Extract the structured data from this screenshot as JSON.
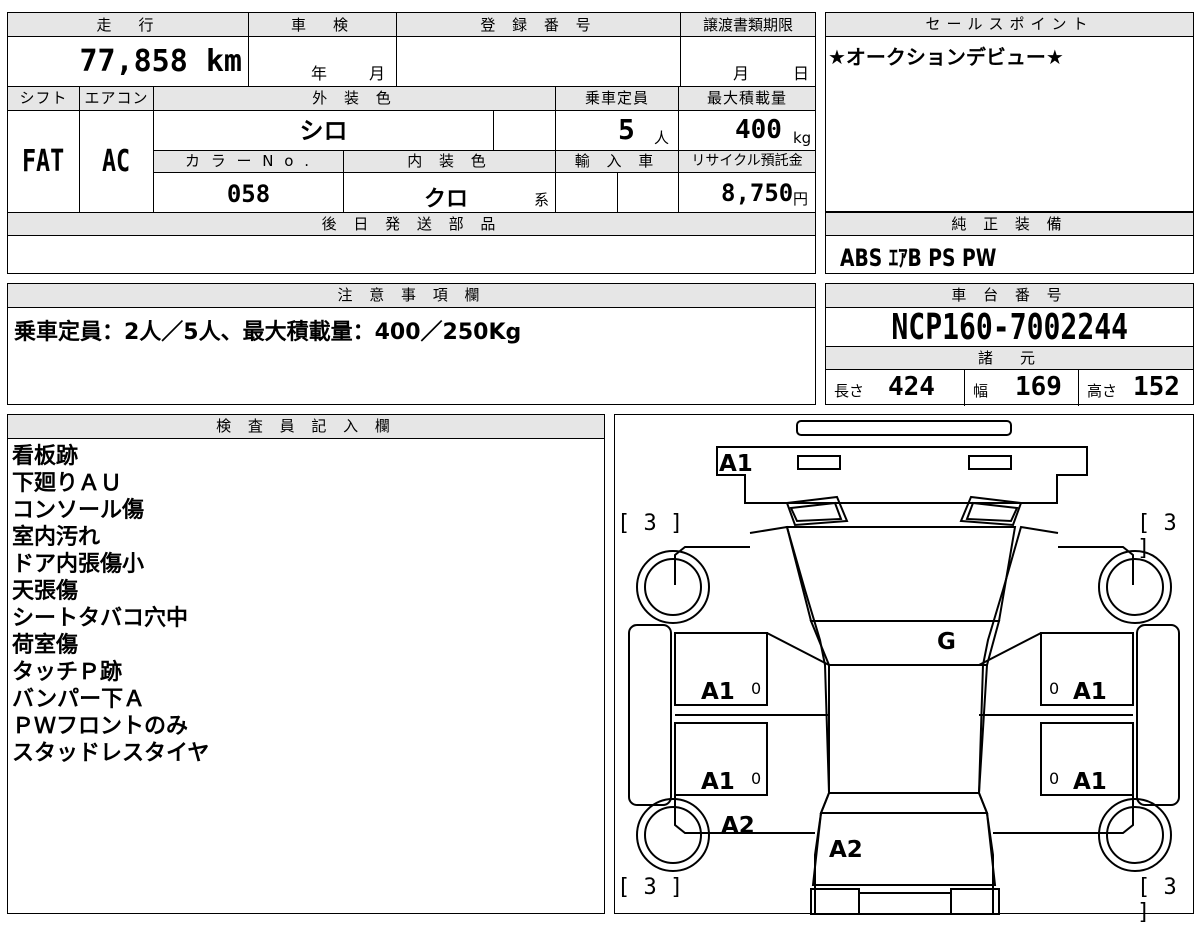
{
  "top": {
    "mileage_label": "走　行",
    "mileage_value": "77,858 km",
    "shaken_label": "車　検",
    "shaken_year": "年",
    "shaken_month": "月",
    "reg_label": "登 録 番 号",
    "reg_value": "",
    "deadline_label": "譲渡書類期限",
    "deadline_month": "月",
    "deadline_day": "日",
    "shift_label": "シフト",
    "shift_value": "FAT",
    "ac_label": "エアコン",
    "ac_value": "AC",
    "exterior_label": "外 装 色",
    "exterior_value": "シロ",
    "capacity_label": "乗車定員",
    "capacity_value": "5",
    "capacity_unit": "人",
    "load_label": "最大積載量",
    "load_value": "400",
    "load_unit": "kg",
    "color_no_label": "カ ラ ー N o .",
    "color_no_value": "058",
    "interior_label": "内 装 色",
    "interior_value": "クロ",
    "interior_suffix": "系",
    "import_label": "輸 入 車",
    "recycle_label": "リサイクル預託金",
    "recycle_value": "8,750",
    "recycle_unit": "円",
    "later_parts_label": "後 日 発 送 部 品"
  },
  "sales": {
    "label": "セールスポイント",
    "text": "★オークションデビュー★"
  },
  "equipment": {
    "label": "純 正 装 備",
    "text": "ABS  ｴｱB  PS  PW"
  },
  "caution": {
    "label": "注 意 事 項 欄",
    "text": "乗車定員：2人／5人、最大積載量：400／250Kg"
  },
  "chassis": {
    "label": "車 台 番 号",
    "value": "NCP160-7002244"
  },
  "specs": {
    "label": "諸　元",
    "length_label": "長さ",
    "length_value": "424",
    "width_label": "幅",
    "width_value": "169",
    "height_label": "高さ",
    "height_value": "152"
  },
  "inspector": {
    "label": "検 査 員 記 入 欄",
    "notes": [
      "看板跡",
      "下廻りＡＵ",
      "コンソール傷",
      "室内汚れ",
      "ドア内張傷小",
      "天張傷",
      "シートタバコ穴中",
      "荷室傷",
      "タッチＰ跡",
      "バンパー下Ａ",
      "ＰＷフロントのみ",
      "スタッドレスタイヤ"
    ]
  },
  "diagram": {
    "marks": {
      "front": "A1",
      "glass": "G",
      "left_front_door": "A1",
      "right_front_door": "A1",
      "left_rear_door": "A1",
      "right_rear_door": "A1",
      "left_rear_fender": "A2",
      "rear": "A2",
      "small_0": "0"
    },
    "tire_tread": "[ 3 ]"
  }
}
